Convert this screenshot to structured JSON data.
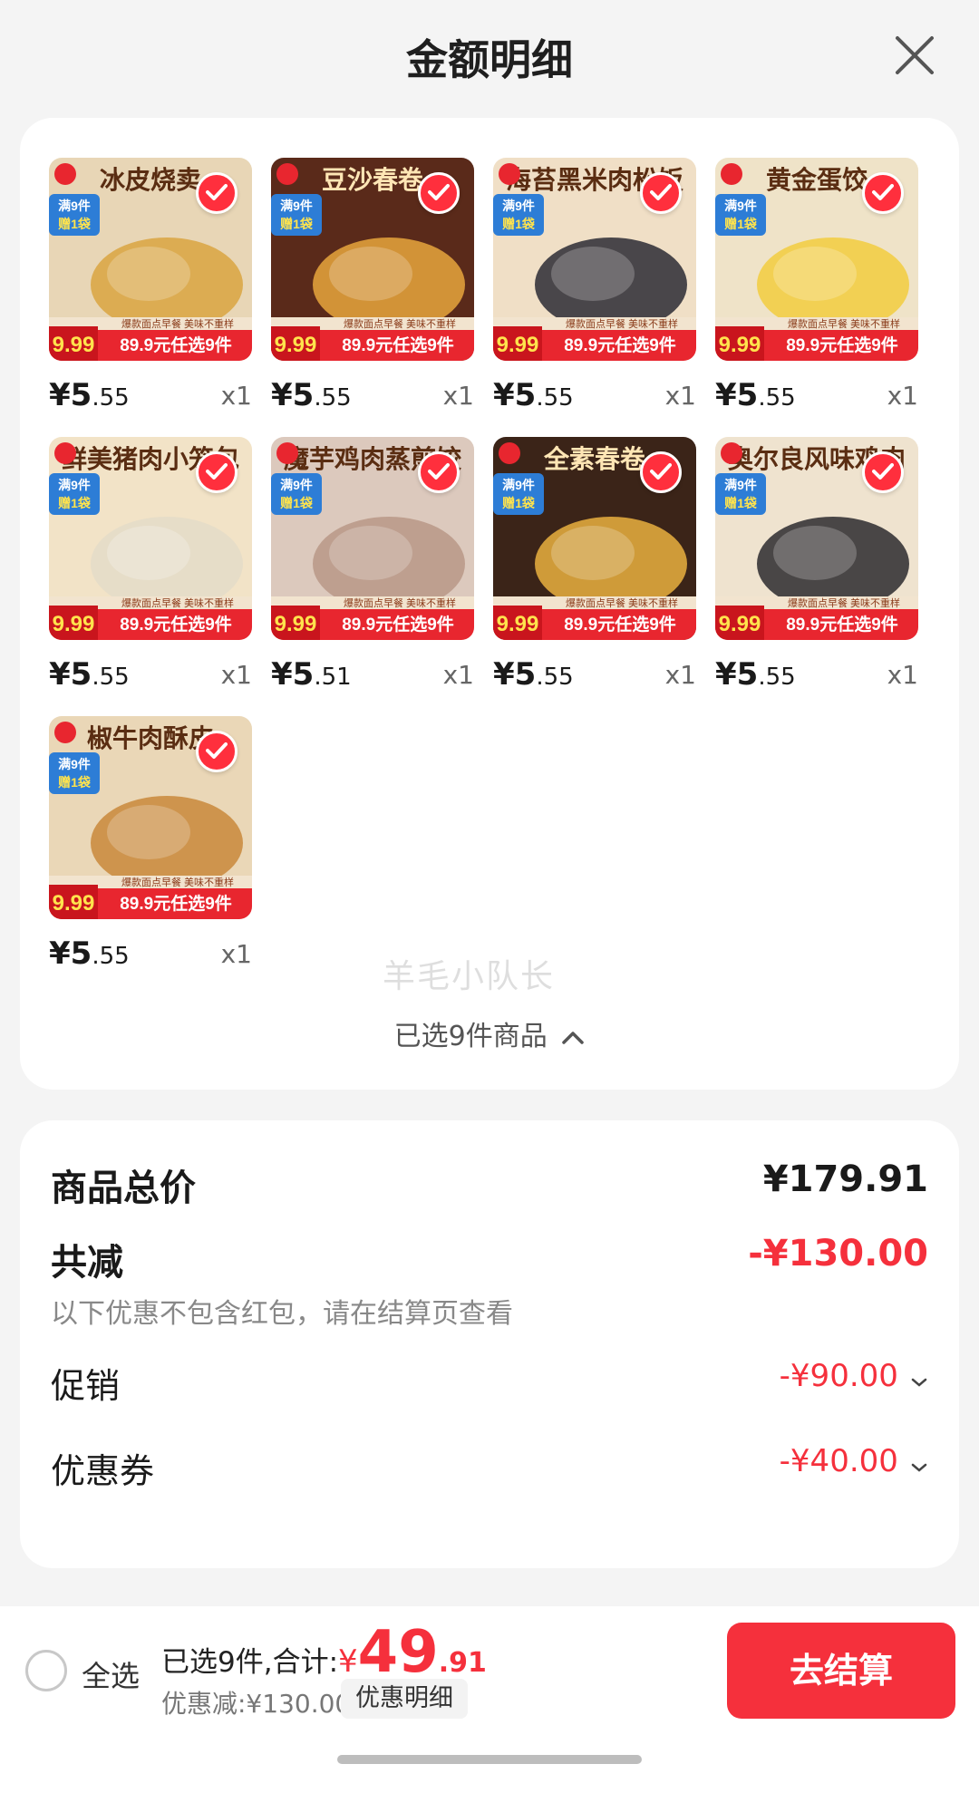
{
  "header": {
    "title": "金额明细"
  },
  "products": [
    {
      "title": "冰皮烧卖",
      "price_int": "¥5",
      "price_dec": ".55",
      "qty": "x1",
      "bg": "#e8d6b6",
      "accent": "#d9a441"
    },
    {
      "title": "豆沙春卷",
      "price_int": "¥5",
      "price_dec": ".55",
      "qty": "x1",
      "bg": "#5a2a1a",
      "accent": "#e7a63d"
    },
    {
      "title": "海苔黑米肉松饭",
      "price_int": "¥5",
      "price_dec": ".55",
      "qty": "x1",
      "bg": "#f0dfc6",
      "accent": "#2c2c34"
    },
    {
      "title": "黄金蛋饺",
      "price_int": "¥5",
      "price_dec": ".55",
      "qty": "x1",
      "bg": "#efe3c8",
      "accent": "#f2cc3e"
    },
    {
      "title": "鲜美猪肉小笼包",
      "price_int": "¥5",
      "price_dec": ".55",
      "qty": "x1",
      "bg": "#f2e3c7",
      "accent": "#e4dcc8"
    },
    {
      "title": "魔芋鸡肉蒸煎饺",
      "price_int": "¥5",
      "price_dec": ".51",
      "qty": "x1",
      "bg": "#dcc9bd",
      "accent": "#b99887"
    },
    {
      "title": "全素春卷",
      "price_int": "¥5",
      "price_dec": ".55",
      "qty": "x1",
      "bg": "#3b2418",
      "accent": "#eab040"
    },
    {
      "title": "奥尔良风味鸡肉",
      "price_int": "¥5",
      "price_dec": ".55",
      "qty": "x1",
      "bg": "#efe3cf",
      "accent": "#2b2a2e"
    },
    {
      "title": "椒牛肉酥皮",
      "price_int": "¥5",
      "price_dec": ".55",
      "qty": "x1",
      "bg": "#ead7b7",
      "accent": "#c9883b"
    }
  ],
  "product_banner": {
    "price_tag": "9.99",
    "offer": "89.9元任选9件",
    "slogan": "爆款面点早餐 美味不重样",
    "promo": "满9件赠1袋"
  },
  "watermark": "羊毛小队长",
  "selected_toggle": "已选9件商品",
  "summary": {
    "total_label": "商品总价",
    "total_value": "¥179.91",
    "reduce_label": "共减",
    "reduce_value": "-¥130.00",
    "note": "以下优惠不包含红包，请在结算页查看",
    "promo_label": "促销",
    "promo_value": "-¥90.00",
    "coupon_label": "优惠券",
    "coupon_value": "-¥40.00"
  },
  "bottom": {
    "select_all": "全选",
    "selected_text": "已选9件,合计:",
    "currency": "¥",
    "amount_int": "49",
    "amount_dec": ".91",
    "discount": "优惠减:¥130.00",
    "detail_button": "优惠明细",
    "checkout": "去结算"
  },
  "colors": {
    "accent": "#f5303c"
  }
}
